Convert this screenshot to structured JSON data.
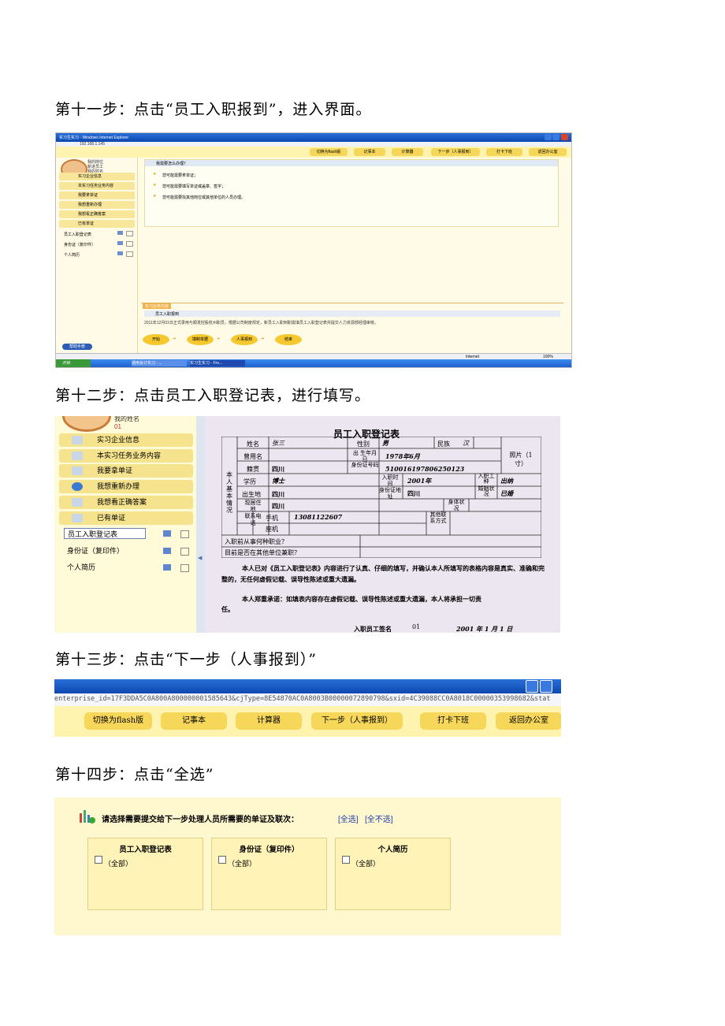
{
  "steps": {
    "step11": "第十一步：点击“员工入职报到”，进入界面。",
    "step12": "第十二步：点击员工入职登记表，进行填写。",
    "step13": "第十三步：点击“下一步（人事报到）”",
    "step14": "第十四步：点击“全选”"
  },
  "shot1": {
    "window_title": "实习生实习 - Windows Internet Explorer",
    "address": "192.168.1.145",
    "toolbar": [
      "切换为flash版",
      "记事本",
      "计算器",
      "下一步（人事报到）",
      "打卡下班",
      "返回办公室"
    ],
    "profile": {
      "position": "我的岗位",
      "role": "新进员工",
      "name": "我的姓名",
      "id": "01"
    },
    "menu": [
      "实习企业信息",
      "本实习任务业务内容",
      "我要拿单证",
      "我想重新办理",
      "我想看正确答案",
      "已有单证"
    ],
    "docs": [
      "员工入职登记表",
      "身份证（复印件）",
      "个人简历"
    ],
    "help_button": "帮助手册",
    "qa_title": "我需要怎么办理？",
    "qa_items": [
      "您可能需要拿单证；",
      "您可能需要填写单证或盖章、签字；",
      "您可能需要找其他岗位或其他单位的人员办理。"
    ],
    "task_tab": "实习业务内容",
    "task_title": "员工入职报到",
    "task_desc": "2011年12月01日正式录用与顺发控股杭州职员，根据公司制度规定，新员工入职到职需填员工入职登记表并提交人力资源部经理审核。",
    "flow": [
      "开始",
      "填制单据",
      "人事报到",
      "结束"
    ],
    "status_zone": "Internet",
    "zoom": "100%",
    "start": "开始",
    "tasks": [
      "通用会计实习 - ...",
      "实习生实习 - Fro..."
    ]
  },
  "shot2": {
    "profile_name": "我的姓名",
    "profile_id": "01",
    "menu": [
      "实习企业信息",
      "本实习任务业务内容",
      "我要拿单证",
      "我想重新办理",
      "我想看正确答案",
      "已有单证"
    ],
    "docs": [
      "员工入职登记表",
      "身份证（复印件）",
      "个人简历"
    ],
    "form": {
      "title": "员工入职登记表",
      "side_label": "本人基本情况",
      "labels": {
        "name": "姓名",
        "gender": "性别",
        "ethnic": "民族",
        "photo": "照片（1寸）",
        "used_name": "曾用名",
        "birth": "出 生年月日",
        "origin": "籍贯",
        "idno": "身份证号码",
        "edu": "学历",
        "entry_time": "入职时间",
        "entry_type": "入职工种",
        "birthplace": "出生地",
        "id_addr": "身份证地址",
        "marriage": "婚姻状况",
        "residence": "现居住地",
        "health": "身体状况",
        "phone": "联系电话",
        "mobile": "手机",
        "landline": "座机",
        "other": "其他联系方式",
        "q1": "入职前从事何种职业？",
        "q2": "目前是否在其他单位兼职？"
      },
      "values": {
        "name": "张三",
        "gender": "男",
        "ethnic": "汉",
        "birth": "1978年6月",
        "origin": "四川",
        "idno": "510016197806250123",
        "edu": "博士",
        "entry_time": "2001年",
        "entry_type": "出纳",
        "birthplace": "四川",
        "id_addr": "四川",
        "marriage": "已婚",
        "residence": "四川",
        "mobile": "13081122607"
      },
      "stmt1": "本人已对《员工入职登记表》内容进行了认真、仔细的填写，并确认本人所填写的表格内容是真实、准确和完整的，无任何虚假记载、误导性陈述或重大遗漏。",
      "stmt2": "本人郑重承诺：如填表内容存在虚假记载、误导性陈述或重大遗漏，本人将承担一切责任。",
      "sign_label": "入职员工签名",
      "sign_value": "01",
      "date": "2001 年 1 月 1 日"
    }
  },
  "shot3": {
    "url": "enterprise_id=17F3DDA5C0A800A800000001585643&cjType=8E54870AC0A8003B00000072890798&sxid=4C39088CC0A8018C00000353998682&stat",
    "toolbar": [
      "切换为flash版",
      "记事本",
      "计算器",
      "下一步（人事报到）",
      "打卡下班",
      "返回办公室"
    ]
  },
  "shot4": {
    "prompt": "请选择需要提交给下一步处理人员所需要的单证及联次：",
    "select_all": "[全选]",
    "select_none": "[全不选]",
    "boxes": [
      {
        "title": "员工入职登记表",
        "option": "（全部）"
      },
      {
        "title": "身份证（复印件）",
        "option": "（全部）"
      },
      {
        "title": "个人简历",
        "option": "（全部）"
      }
    ]
  },
  "colors": {
    "ie_blue": "#0c48b0",
    "button_yellow": "#f7d75a",
    "panel_yellow": "#fffbe6"
  }
}
